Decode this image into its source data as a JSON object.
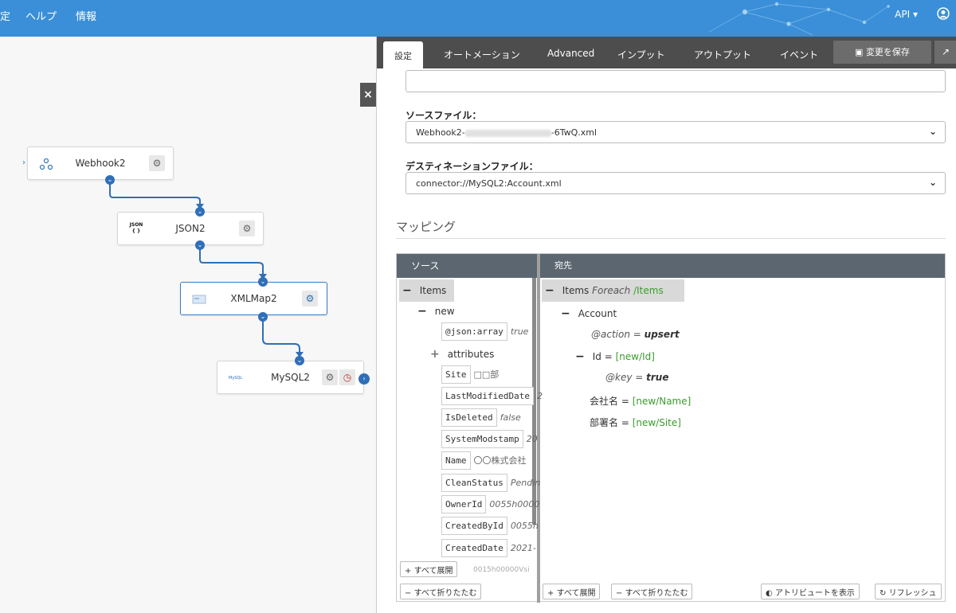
{
  "topbar": {
    "nav": [
      "定",
      "ヘルプ",
      "情報"
    ],
    "api": "API ▾",
    "accent": "#3a8fd8"
  },
  "flow": {
    "nodes": [
      {
        "label": "Webhook2",
        "icon": "webhook-icon"
      },
      {
        "label": "JSON2",
        "icon": "json-icon",
        "icon_text": "JSON"
      },
      {
        "label": "XMLMap2",
        "icon": "xmlmap-icon"
      },
      {
        "label": "MySQL2",
        "icon": "mysql-icon",
        "icon_text": "MySQL"
      }
    ],
    "close": "×"
  },
  "tabs": [
    "設定",
    "オートメーション",
    "Advanced",
    "インプット",
    "アウトプット",
    "イベント"
  ],
  "save_label": "変更を保存",
  "form": {
    "source_label": "ソースファイル：",
    "source_prefix": "Webhook2-",
    "source_suffix": "-6TwQ.xml",
    "dest_label": "デスティネーションファイル：",
    "dest_value": "connector://MySQL2:Account.xml"
  },
  "mapping": {
    "title": "マッピング",
    "source_header": "ソース",
    "dest_header": "宛先",
    "source_tree": {
      "items": "Items",
      "new": "new",
      "json_array": "@json:array",
      "json_array_val": "true",
      "attributes": "attributes",
      "fields": [
        {
          "name": "Site",
          "value": "□□部"
        },
        {
          "name": "LastModifiedDate",
          "value": "2"
        },
        {
          "name": "IsDeleted",
          "value": "false"
        },
        {
          "name": "SystemModstamp",
          "value": "20"
        },
        {
          "name": "Name",
          "value": "〇〇株式会社"
        },
        {
          "name": "CleanStatus",
          "value": "Pendin"
        },
        {
          "name": "OwnerId",
          "value": "0055h0000"
        },
        {
          "name": "CreatedById",
          "value": "0055h"
        },
        {
          "name": "CreatedDate",
          "value": "2021-"
        }
      ],
      "partial_row": "0015h00000Vsi"
    },
    "dest_tree": {
      "items": "Items",
      "foreach": "Foreach",
      "items_path": "/Items",
      "account": "Account",
      "action_key": "@action",
      "action_val": "upsert",
      "id_label": "Id =",
      "id_ref": "[new/Id]",
      "key_key": "@key",
      "key_val": "true",
      "company_label": "会社名 =",
      "company_ref": "[new/Name]",
      "dept_label": "部署名 =",
      "dept_ref": "[new/Site]",
      "eq": "="
    },
    "buttons": {
      "expand_all": "すべて展開",
      "collapse_all": "すべて折りたたむ",
      "show_attrs": "アトリビュートを表示",
      "refresh": "リフレッシュ"
    }
  }
}
